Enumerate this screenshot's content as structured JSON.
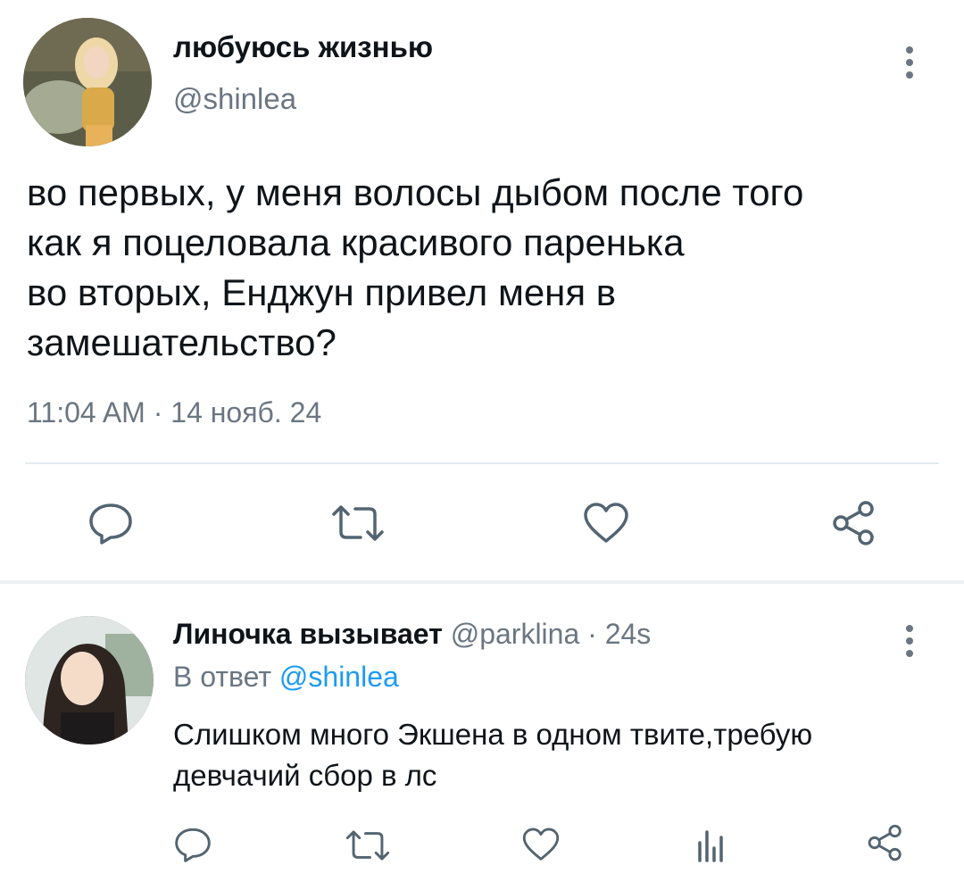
{
  "tweet": {
    "author_name": "любуюсь жизнью",
    "author_handle": "@shinlea",
    "lines": [
      "во первых, у меня волосы дыбом после того",
      "как я поцеловала красивого паренька",
      "во вторых, Енджун привел меня в",
      "замешательство?"
    ],
    "time": "11:04 AM · 14 нояб. 24",
    "actions": [
      "reply-icon",
      "retweet-icon",
      "like-icon",
      "share-icon"
    ]
  },
  "reply": {
    "author_name": "Линочка вызывает",
    "author_handle": "@parklina",
    "time": "· 24s",
    "reply_to_prefix": "В ответ",
    "reply_to_handle": "@shinlea",
    "lines": [
      "Слишком много Экшена в одном твите,требую",
      "девчачий сбор в лс"
    ],
    "actions": [
      "reply-icon",
      "retweet-icon",
      "like-icon",
      "stats-icon",
      "share-icon"
    ]
  },
  "colors": {
    "text": "#0f1419",
    "muted": "#6a7682",
    "link": "#1d9bf0",
    "divider": "#e6ecf0"
  }
}
